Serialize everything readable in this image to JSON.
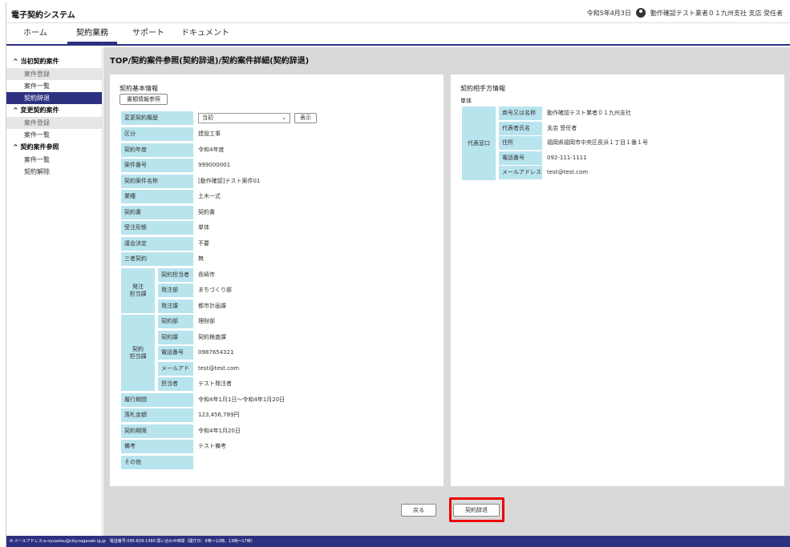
{
  "app": {
    "title": "電子契約システム"
  },
  "header": {
    "date": "令和5年4月3日",
    "user": "動作確認テスト業者０１九州支社 支店 受任者"
  },
  "nav": {
    "tabs": [
      "ホーム",
      "契約業務",
      "サポート",
      "ドキュメント"
    ]
  },
  "sidebar": {
    "groups": [
      {
        "label": "当初契約案件",
        "items": [
          "案件登録",
          "案件一覧",
          "契約辞退"
        ]
      },
      {
        "label": "変更契約案件",
        "items": [
          "案件登録",
          "案件一覧"
        ]
      },
      {
        "label": "契約案件参照",
        "items": [
          "案件一覧",
          "契約解除"
        ]
      }
    ]
  },
  "page": {
    "breadcrumb": "TOP/契約案件参照(契約辞退)/契約案件詳細(契約辞退)"
  },
  "basic": {
    "title": "契約基本情報",
    "doc_button": "書類情報参照",
    "history_label": "変更契約履歴",
    "history_value": "当初",
    "show_button": "表示",
    "rows1": [
      {
        "label": "区分",
        "value": "建設工事"
      },
      {
        "label": "契約年度",
        "value": "令和4年度"
      },
      {
        "label": "案件番号",
        "value": "999000001"
      },
      {
        "label": "契約案件名称",
        "value": "[動作確認]テスト案件01"
      },
      {
        "label": "業種",
        "value": "土木一式"
      },
      {
        "label": "契約書",
        "value": "契約書"
      },
      {
        "label": "受注形態",
        "value": "単体"
      },
      {
        "label": "議会決定",
        "value": "不要"
      },
      {
        "label": "三者契約",
        "value": "無"
      }
    ],
    "order_group": {
      "label": "発注\n担当課",
      "rows": [
        {
          "label": "契約担当者",
          "value": "長崎市"
        },
        {
          "label": "発注部",
          "value": "まちづくり部"
        },
        {
          "label": "発注課",
          "value": "都市計画課"
        }
      ]
    },
    "contract_group": {
      "label": "契約\n担当課",
      "rows": [
        {
          "label": "契約部",
          "value": "理財部"
        },
        {
          "label": "契約課",
          "value": "契約検査課"
        },
        {
          "label": "電話番号",
          "value": "0987654321"
        },
        {
          "label": "メールアドレス",
          "value": "test@test.com"
        },
        {
          "label": "担当者",
          "value": "テスト発注者"
        }
      ]
    },
    "rows2": [
      {
        "label": "履行期間",
        "value": "令和4年1月1日～令和4年1月20日"
      },
      {
        "label": "落札金額",
        "value": "123,456,789円"
      },
      {
        "label": "契約期限",
        "value": "令和4年1月20日"
      },
      {
        "label": "備考",
        "value": "テスト備考"
      },
      {
        "label": "その他",
        "value": ""
      }
    ]
  },
  "partner": {
    "title": "契約相手方情報",
    "type": "単体",
    "group_label": "代表窓口",
    "rows": [
      {
        "label": "商号又は名称",
        "value": "動作確認テスト業者０１九州支社"
      },
      {
        "label": "代表者氏名",
        "value": "支店 受任者"
      },
      {
        "label": "住所",
        "value": "福岡県福岡市中央区長浜１丁目１番１号"
      },
      {
        "label": "電話番号",
        "value": "092-111-1111"
      },
      {
        "label": "メールアドレス",
        "value": "test@test.com"
      }
    ]
  },
  "actions": {
    "back": "戻る",
    "decline": "契約辞退"
  },
  "footer": {
    "text": "メールアドレス:e-nyusatsu@city.nagasaki.lg.jp　電話番号:095-829-1360 問い合わせ時間（開庁日：9時～12時、13時～17時）"
  }
}
